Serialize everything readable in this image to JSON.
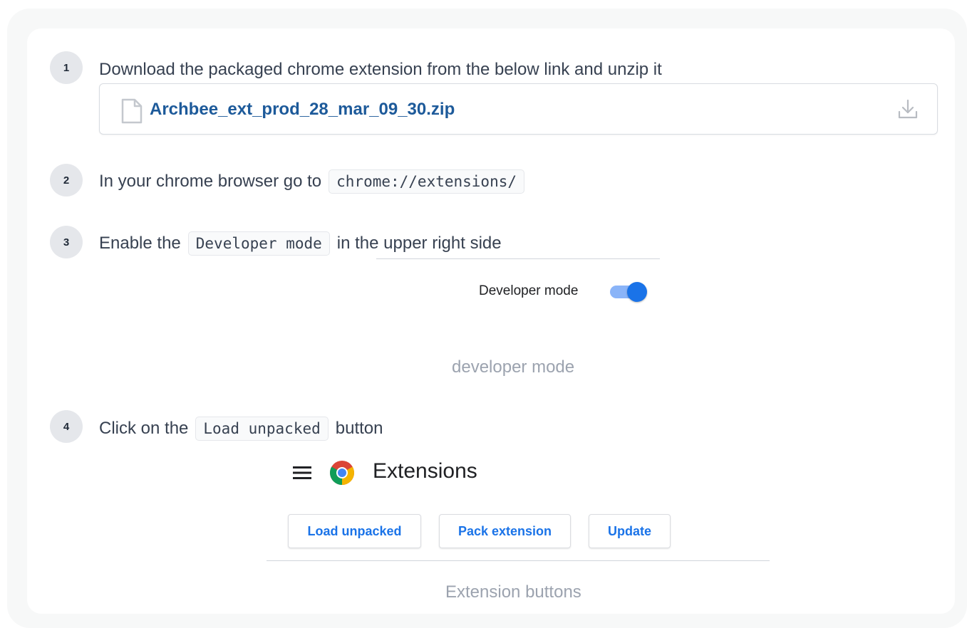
{
  "steps": [
    {
      "number": "1",
      "text": "Download the packaged chrome extension from the below link and unzip it"
    },
    {
      "number": "2",
      "text_before": "In your chrome browser go to",
      "code": "chrome://extensions/"
    },
    {
      "number": "3",
      "text_before": "Enable the",
      "code": "Developer mode",
      "text_after": "in the upper right side"
    },
    {
      "number": "4",
      "text_before": "Click on the",
      "code": "Load unpacked",
      "text_after": "button"
    }
  ],
  "file": {
    "name": "Archbee_ext_prod_28_mar_09_30.zip",
    "icon": "file-icon",
    "action_icon": "download-icon"
  },
  "devmode_image": {
    "label": "Developer mode",
    "toggle_on": true,
    "toggle_color": "#1a73e8",
    "caption": "developer mode"
  },
  "extensions_image": {
    "title": "Extensions",
    "buttons": [
      "Load unpacked",
      "Pack extension",
      "Update"
    ],
    "caption": "Extension buttons"
  }
}
